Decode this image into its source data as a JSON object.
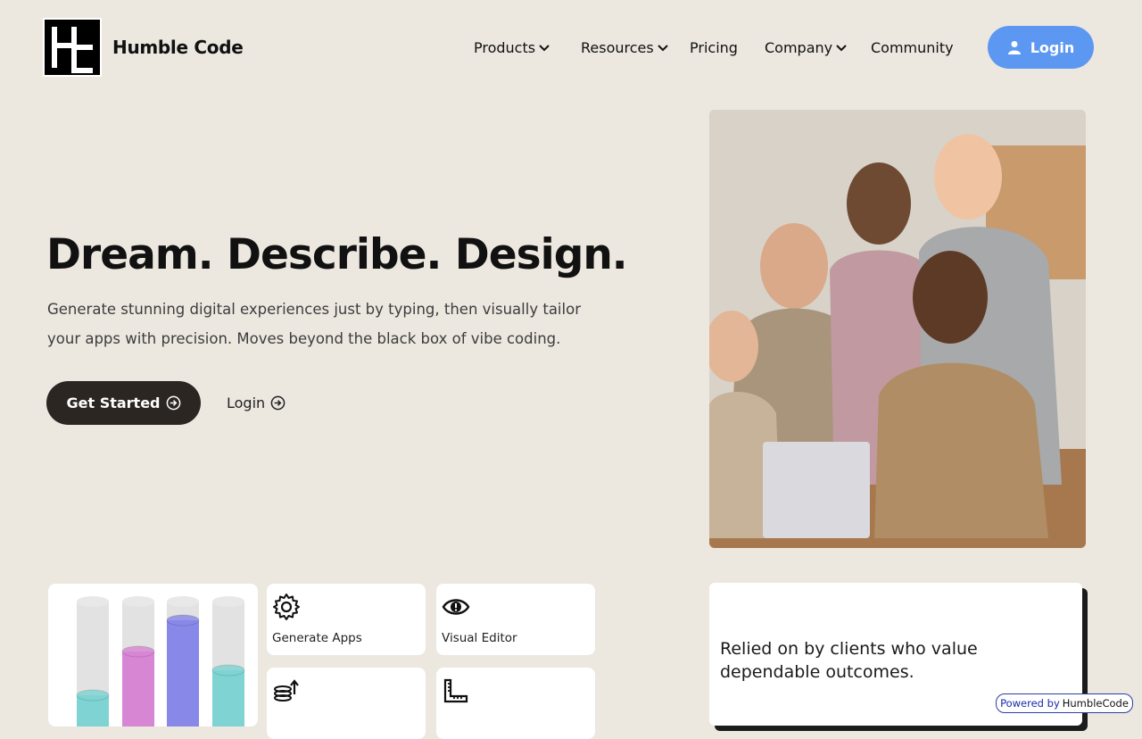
{
  "header": {
    "brand": "Humble Code",
    "nav": [
      {
        "label": "Products",
        "has_dropdown": true
      },
      {
        "label": "Resources",
        "has_dropdown": true
      },
      {
        "label": "Pricing",
        "has_dropdown": false
      },
      {
        "label": "Company",
        "has_dropdown": true
      },
      {
        "label": "Community",
        "has_dropdown": false
      }
    ],
    "login_label": "Login"
  },
  "hero": {
    "title": "Dream. Describe. Design.",
    "subtitle": "Generate stunning digital experiences just by typing, then visually tailor your apps with precision. Moves beyond the black box of vibe coding.",
    "cta_primary": "Get Started",
    "cta_secondary": "Login"
  },
  "features": [
    {
      "label": "Generate Apps",
      "icon": "gear-icon"
    },
    {
      "label": "Visual Editor",
      "icon": "eye-icon"
    },
    {
      "label": "",
      "icon": "coins-upload-icon"
    },
    {
      "label": "",
      "icon": "ruler-icon"
    }
  ],
  "chart_preview": {
    "fill_levels": [
      0.25,
      0.6,
      0.85,
      0.45
    ],
    "colors": [
      "#7fd3d3",
      "#d786d3",
      "#8888e8",
      "#7fd3d3"
    ]
  },
  "trust": {
    "text": "Relied on by clients who value dependable outcomes."
  },
  "badge": {
    "powered_by": "Powered by",
    "brand": "HumbleCode"
  },
  "colors": {
    "background": "#ece7df",
    "accent_blue": "#5c98f2",
    "dark_button": "#2b2622"
  }
}
